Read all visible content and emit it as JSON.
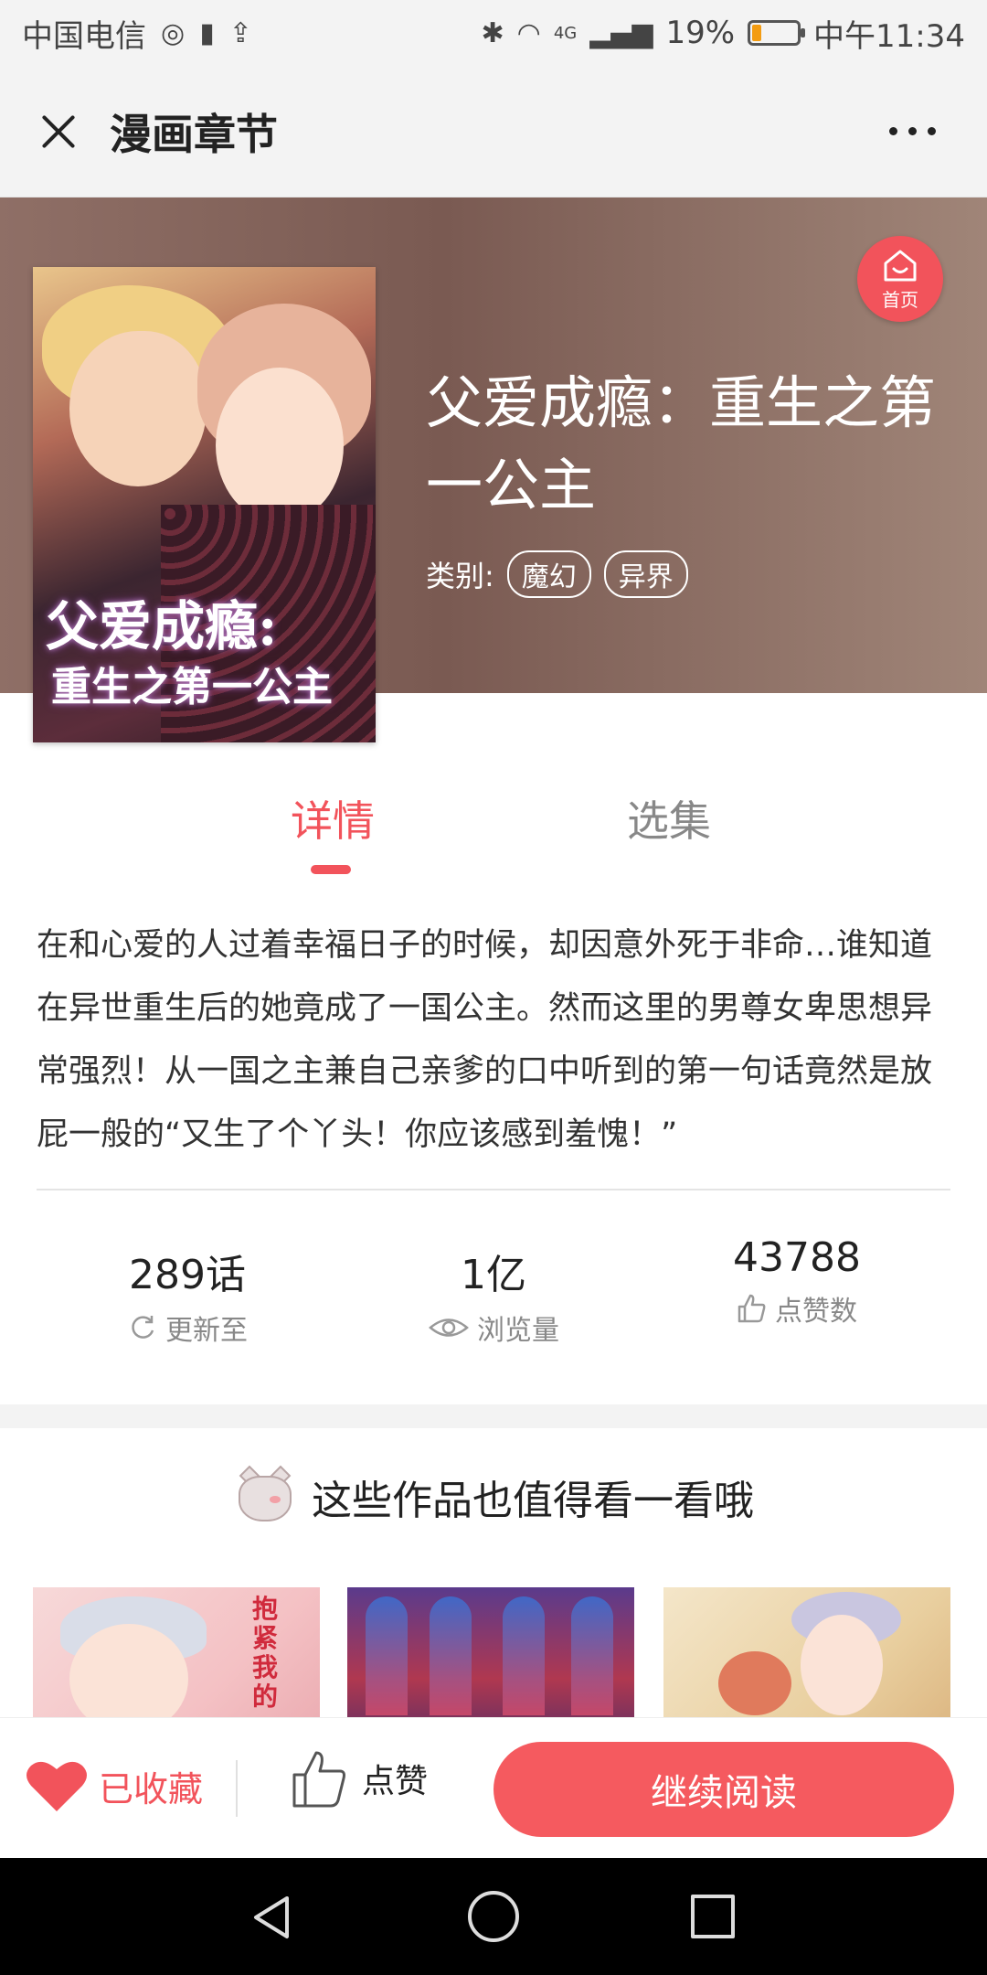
{
  "status_bar": {
    "carrier": "中国电信",
    "network": "4G",
    "battery": "19%",
    "battery_level": 0.19,
    "time": "中午11:34"
  },
  "header": {
    "title": "漫画章节"
  },
  "home_badge": {
    "label": "首页"
  },
  "comic": {
    "title": "父爱成瘾：重生之第一公主",
    "category_label": "类别:",
    "tags": [
      "魔幻",
      "异界"
    ],
    "cover_text_line1": "父爱成瘾:",
    "cover_text_line2": "重生之第一公主"
  },
  "tabs": [
    {
      "label": "详情",
      "active": true
    },
    {
      "label": "选集",
      "active": false
    }
  ],
  "description": "在和心爱的人过着幸福日子的时候，却因意外死于非命…谁知道在异世重生后的她竟成了一国公主。然而这里的男尊女卑思想异常强烈！从一国之主兼自己亲爹的口中听到的第一句话竟然是放屁一般的“又生了个丫头！你应该感到羞愧！”",
  "stats": [
    {
      "value": "289话",
      "label": "更新至",
      "icon": "refresh-icon"
    },
    {
      "value": "1亿",
      "label": "浏览量",
      "icon": "eye-icon"
    },
    {
      "value": "43788",
      "label": "点赞数",
      "icon": "thumbs-up-icon"
    }
  ],
  "recommend": {
    "heading": "这些作品也值得看一看哦",
    "cards": [
      {
        "cover_text": "抱紧我的"
      },
      {
        "cover_text": ""
      },
      {
        "cover_text": ""
      }
    ]
  },
  "action_bar": {
    "favorite_label": "已收藏",
    "like_label": "点赞",
    "continue_label": "继续阅读"
  },
  "colors": {
    "accent": "#f2535b",
    "continue_button": "#f55a5f"
  }
}
